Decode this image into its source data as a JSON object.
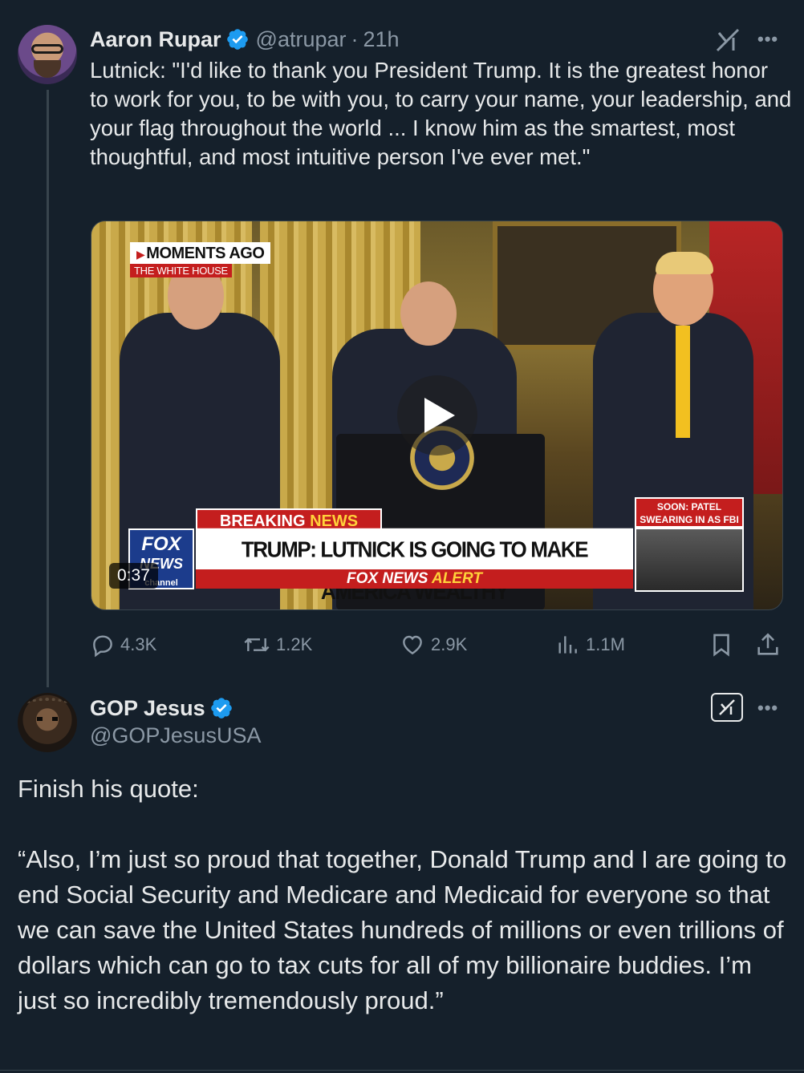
{
  "tweet1": {
    "display_name": "Aaron Rupar",
    "handle": "@atrupar",
    "separator": "·",
    "time": "21h",
    "text": "Lutnick: \"I'd like to thank you President Trump. It is the greatest honor to work for you, to be with you, to carry your name, your leadership, and your flag throughout the world ... I know him as the smartest, most thoughtful, and most intuitive person I've ever met.\"",
    "video": {
      "moments_label": "MOMENTS AGO",
      "location_label": "THE WHITE HOUSE",
      "breaking_label_1": "BREAKING",
      "breaking_label_2": "NEWS",
      "headline": "TRUMP: LUTNICK IS GOING TO MAKE AMERICA WEALTHY",
      "alert_label_1": "FOX NEWS",
      "alert_label_2": "ALERT",
      "network_logo_1": "FOX",
      "network_logo_2": "NEWS",
      "network_logo_3": "channel",
      "soon_label": "SOON: PATEL SWEARING IN AS FBI DIRECTOR",
      "duration": "0:37"
    },
    "stats": {
      "replies": "4.3K",
      "reposts": "1.2K",
      "likes": "2.9K",
      "views": "1.1M"
    }
  },
  "tweet2": {
    "display_name": "GOP Jesus",
    "handle": "@GOPJesusUSA",
    "line1": "Finish his quote:",
    "quote": "“Also, I’m just so proud that together, Donald Trump and I are going to end Social Security and Medicare and Medicaid for everyone so that we can save the United States hundreds of millions or even trillions of dollars which can go to tax cuts for all of my billionaire buddies. I’m just so incredibly tremendously proud.”"
  },
  "colors": {
    "background": "#15202b",
    "text_primary": "#e7e9ea",
    "text_secondary": "#8b98a5",
    "verified": "#1d9bf0",
    "border": "#38444d"
  },
  "icons": [
    "verified-badge-icon",
    "grok-icon",
    "more-icon",
    "play-icon",
    "reply-icon",
    "repost-icon",
    "like-icon",
    "views-icon",
    "bookmark-icon",
    "share-icon"
  ]
}
